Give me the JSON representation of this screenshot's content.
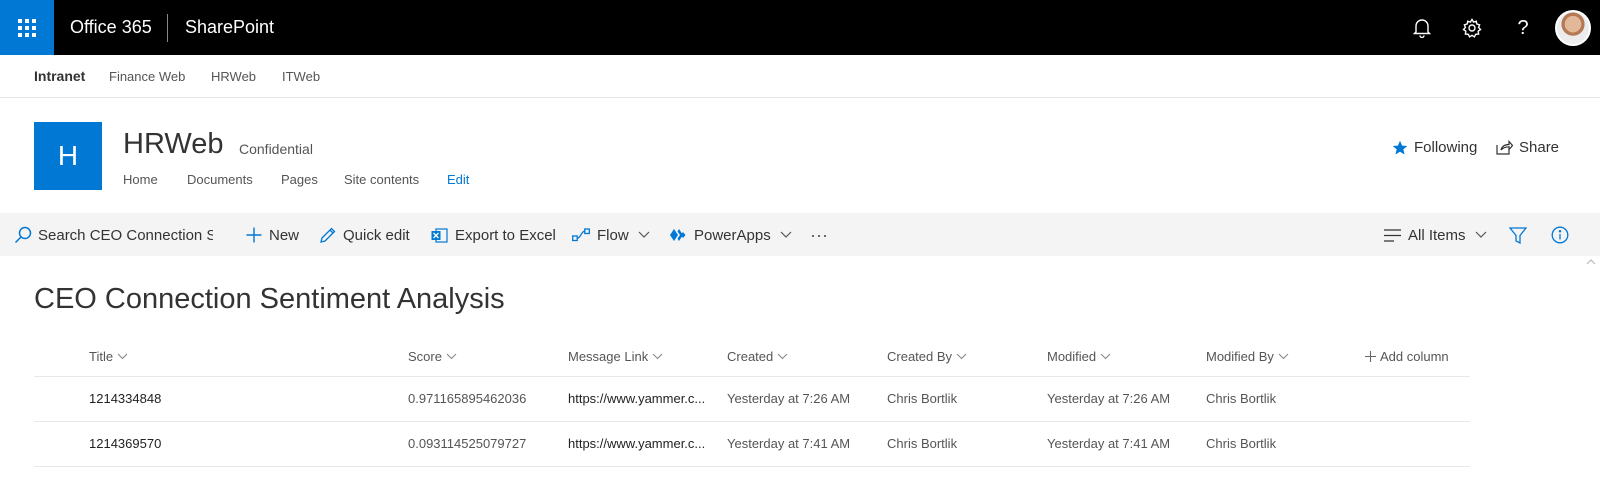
{
  "suite": {
    "brand": "Office 365",
    "app": "SharePoint",
    "icons": [
      "waffle-icon",
      "bell-icon",
      "gear-icon",
      "help-icon"
    ],
    "accent": "#0078d4"
  },
  "hub": {
    "title": "Intranet",
    "links": [
      "Finance Web",
      "HRWeb",
      "ITWeb"
    ]
  },
  "site": {
    "logo_letter": "H",
    "title": "HRWeb",
    "classification": "Confidential",
    "nav": [
      "Home",
      "Documents",
      "Pages",
      "Site contents",
      "Edit"
    ],
    "follow_label": "Following",
    "share_label": "Share"
  },
  "commandbar": {
    "search_placeholder": "Search CEO Connection Sentiment Analysis",
    "new_label": "New",
    "quick_edit_label": "Quick edit",
    "export_label": "Export to Excel",
    "flow_label": "Flow",
    "powerapps_label": "PowerApps",
    "more_label": "···",
    "view_label": "All Items"
  },
  "list": {
    "title": "CEO Connection Sentiment Analysis",
    "columns": [
      "Title",
      "Score",
      "Message Link",
      "Created",
      "Created By",
      "Modified",
      "Modified By"
    ],
    "add_column_label": "Add column",
    "rows": [
      {
        "title": "1214334848",
        "score": "0.971165895462036",
        "link": "https://www.yammer.c...",
        "created": "Yesterday at 7:26 AM",
        "created_by": "Chris Bortlik",
        "modified": "Yesterday at 7:26 AM",
        "modified_by": "Chris Bortlik"
      },
      {
        "title": "1214369570",
        "score": "0.093114525079727",
        "link": "https://www.yammer.c...",
        "created": "Yesterday at 7:41 AM",
        "created_by": "Chris Bortlik",
        "modified": "Yesterday at 7:41 AM",
        "modified_by": "Chris Bortlik"
      }
    ]
  }
}
